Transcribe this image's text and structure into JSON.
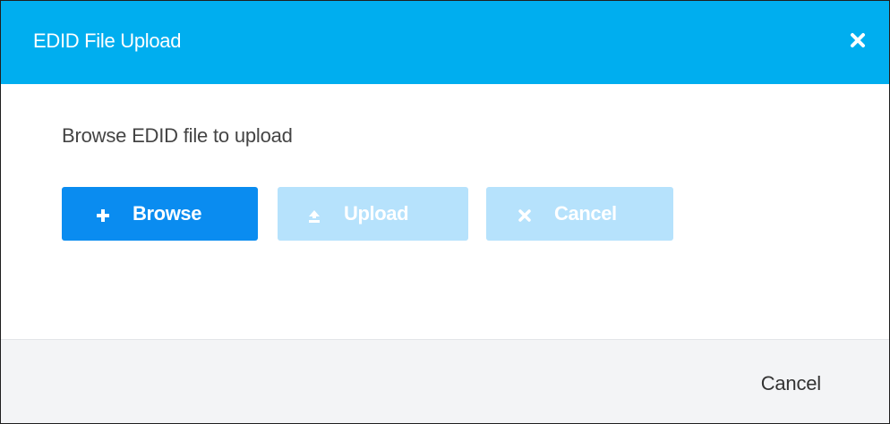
{
  "dialog": {
    "title": "EDID File Upload",
    "close_icon": "close-icon",
    "prompt": "Browse EDID file to upload",
    "buttons": {
      "browse": {
        "label": "Browse",
        "icon": "plus-icon",
        "enabled": true
      },
      "upload": {
        "label": "Upload",
        "icon": "upload-icon",
        "enabled": false
      },
      "cancel": {
        "label": "Cancel",
        "icon": "close-icon",
        "enabled": false
      }
    },
    "footer": {
      "cancel_label": "Cancel"
    }
  },
  "colors": {
    "header": "#00aeef",
    "primary_button": "#0a8cf0",
    "disabled_button": "#b6e2fc",
    "footer_bg": "#f3f4f6"
  }
}
